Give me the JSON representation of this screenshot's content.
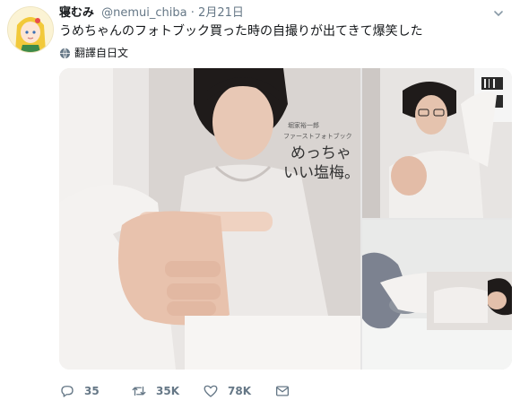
{
  "tweet": {
    "display_name": "寝むみ",
    "handle": "@nemui_chiba",
    "separator": "·",
    "date": "2月21日",
    "text": "うめちゃんのフォトブック買った時の自撮りが出てきて爆笑した",
    "translate_label": "翻譯自日文"
  },
  "book_cover": {
    "author_line": "堀家裕一郎",
    "subtitle_line": "ファーストフォトブック",
    "title_line_1": "めっちゃ",
    "title_line_2": "いい塩梅。"
  },
  "actions": {
    "reply_count": "35",
    "retweet_count": "35K",
    "like_count": "78K"
  },
  "icons": {
    "avatar": "anime-character-avatar",
    "caret": "chevron-down-icon",
    "translate": "globe-icon",
    "reply": "reply-icon",
    "retweet": "retweet-icon",
    "like": "heart-icon",
    "message": "envelope-icon"
  },
  "colors": {
    "text": "#14171a",
    "secondary": "#657786",
    "background": "#ffffff"
  }
}
